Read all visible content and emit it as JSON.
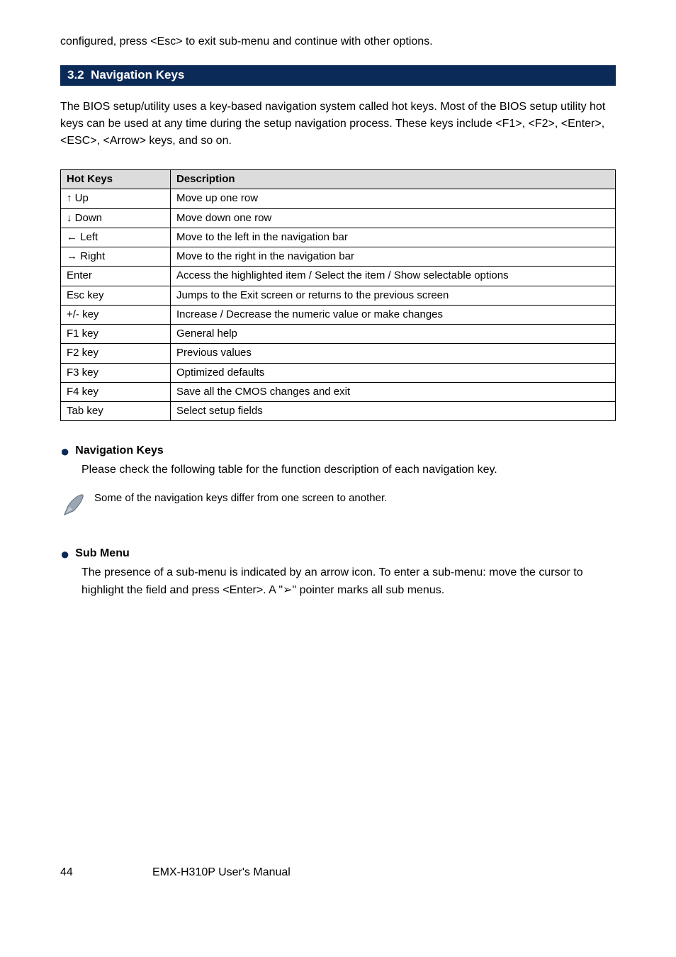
{
  "pre_heading": "configured, press <Esc> to exit sub-menu and continue with other options.",
  "section": {
    "number": "3.2",
    "title": "Navigation Keys"
  },
  "intro": "The BIOS setup/utility uses a key-based navigation system called hot keys. Most of the BIOS setup utility hot keys can be used at any time during the setup navigation process. These keys include <F1>, <F2>, <Enter>, <ESC>, <Arrow> keys, and so on.",
  "table": {
    "headers": [
      "Hot Keys",
      "Description"
    ],
    "rows": [
      [
        "↑ Up",
        "Move up one row"
      ],
      [
        "↓ Down",
        "Move down one row"
      ],
      [
        "← Left",
        "Move to the left in the navigation bar"
      ],
      [
        "→ Right",
        "Move to the right in the navigation bar"
      ],
      [
        "Enter",
        "Access the highlighted item / Select the item / Show selectable options"
      ],
      [
        "Esc key",
        "Jumps to the Exit screen or returns to the previous screen"
      ],
      [
        "+/- key",
        "Increase / Decrease the numeric value or make changes"
      ],
      [
        "F1 key",
        "General help"
      ],
      [
        "F2 key",
        "Previous values"
      ],
      [
        "F3 key",
        "Optimized defaults"
      ],
      [
        "F4 key",
        "Save all the CMOS changes and exit"
      ],
      [
        "Tab key",
        "Select setup fields"
      ]
    ]
  },
  "bullet1": {
    "title": "Navigation Keys",
    "text": "Please check the following table for the function description of each navigation key."
  },
  "note": "Some of the navigation keys differ from one screen to another.",
  "bullet2": {
    "title": "Sub Menu",
    "text": "The presence of a sub-menu is indicated by an arrow icon. To enter a sub-menu: move the cursor to highlight the field and press <Enter>.  A \"➢\" pointer marks all sub menus."
  },
  "footer": {
    "page": "44",
    "left": "EMX-H310P",
    "right": "User's Manual"
  }
}
